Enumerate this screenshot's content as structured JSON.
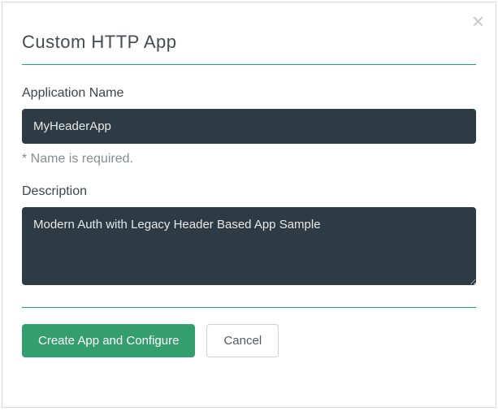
{
  "modal": {
    "title": "Custom HTTP App",
    "close_icon": "×"
  },
  "fields": {
    "name": {
      "label": "Application Name",
      "value": "MyHeaderApp",
      "hint": "* Name is required."
    },
    "description": {
      "label": "Description",
      "value": "Modern Auth with Legacy Header Based App Sample"
    }
  },
  "buttons": {
    "primary": "Create App and Configure",
    "cancel": "Cancel"
  }
}
